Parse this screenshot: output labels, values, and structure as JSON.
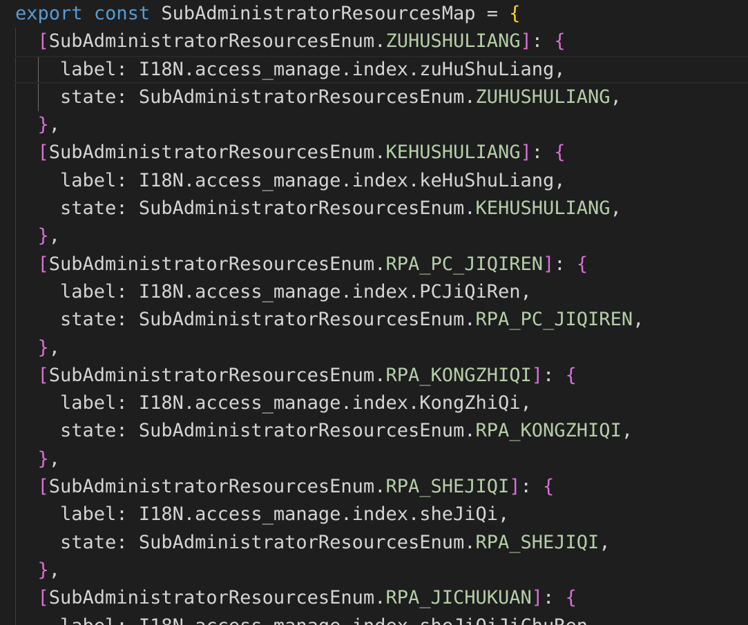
{
  "editor": {
    "header": {
      "export_kw": "export",
      "const_kw": "const",
      "map_name": "SubAdministratorResourcesMap",
      "assign": " = ",
      "open_brace": "{"
    },
    "enum_name": "SubAdministratorResourcesEnum",
    "i18n_prefix": "I18N.access_manage.index.",
    "label_key": "label",
    "state_key": "state",
    "entries": [
      {
        "member": "ZUHUSHULIANG",
        "label": "zuHuShuLiang"
      },
      {
        "member": "KEHUSHULIANG",
        "label": "keHuShuLiang"
      },
      {
        "member": "RPA_PC_JIQIREN",
        "label": "PCJiQiRen"
      },
      {
        "member": "RPA_KONGZHIQI",
        "label": "KongZhiQi"
      },
      {
        "member": "RPA_SHEJIQI",
        "label": "sheJiQi"
      },
      {
        "member": "RPA_JICHUKUAN",
        "label": "sheJiQiJiChuRen"
      }
    ],
    "theme": {
      "background": "#1e1e1e",
      "keyword": "#569cd6",
      "text": "#d4d4d4",
      "member": "#b5cea8",
      "bracket_gold": "#ffd700",
      "bracket_orchid": "#da70d6"
    }
  }
}
